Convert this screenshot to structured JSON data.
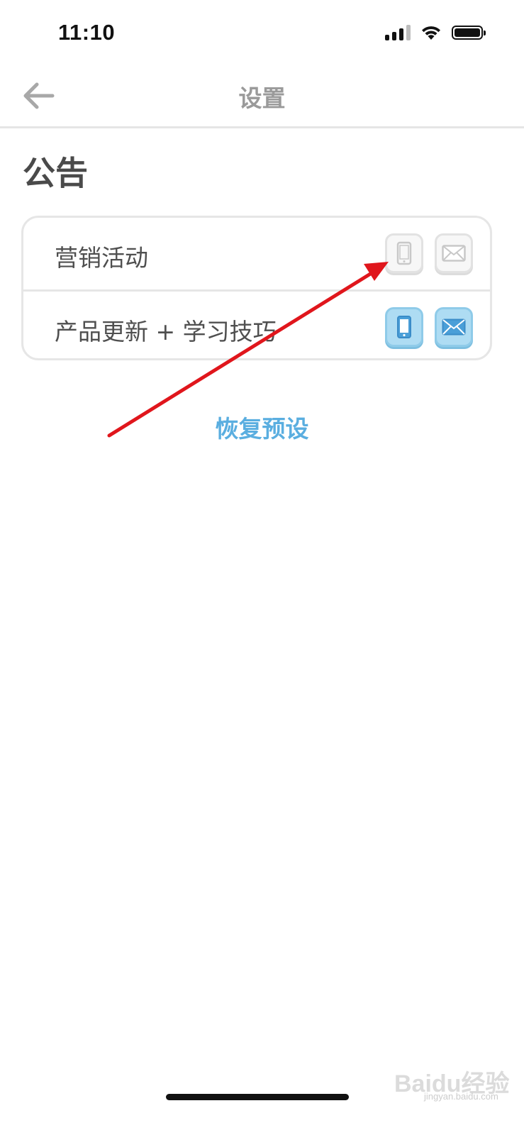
{
  "status_bar": {
    "time": "11:10",
    "icons": [
      "signal-icon",
      "wifi-icon",
      "battery-icon"
    ]
  },
  "nav": {
    "title": "设置",
    "back_icon": "back-arrow-icon"
  },
  "section": {
    "title": "公告"
  },
  "rows": [
    {
      "label": "营销活动",
      "push_enabled": false,
      "email_enabled": false
    },
    {
      "label": "产品更新 + 学习技巧",
      "push_enabled": true,
      "email_enabled": true
    }
  ],
  "reset_label": "恢复预设",
  "watermark": {
    "text": "Baidu经验",
    "sub": "jingyan.baidu.com"
  },
  "colors": {
    "accent": "#5aaee0",
    "toggle_on": "#aedcf3",
    "annotation_arrow": "#e0161c"
  }
}
